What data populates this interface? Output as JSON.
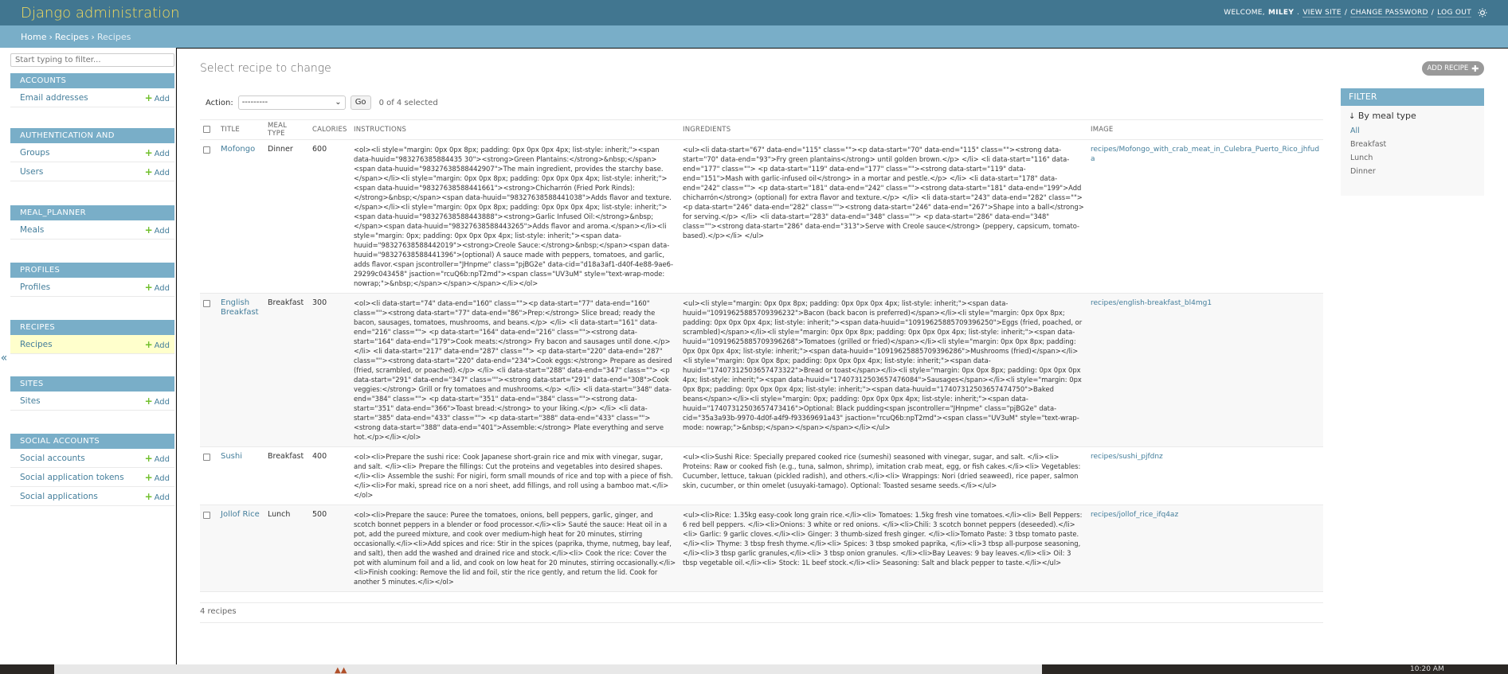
{
  "header": {
    "branding": "Django administration",
    "welcome": "WELCOME,",
    "username": "MILEY",
    "view_site": "VIEW SITE",
    "change_password": "CHANGE PASSWORD",
    "log_out": "LOG OUT",
    "sep": "/"
  },
  "breadcrumbs": {
    "home": "Home",
    "app": "Recipes",
    "current": "Recipes",
    "sep": "›"
  },
  "sidebar": {
    "filter_placeholder": "Start typing to filter...",
    "toggle": "«",
    "add_label": "Add",
    "modules": [
      {
        "caption": "ACCOUNTS",
        "rows": [
          "Email addresses"
        ]
      },
      {
        "caption": "AUTHENTICATION AND AUTHORIZATION",
        "rows": [
          "Groups",
          "Users"
        ]
      },
      {
        "caption": "MEAL_PLANNER",
        "rows": [
          "Meals"
        ]
      },
      {
        "caption": "PROFILES",
        "rows": [
          "Profiles"
        ]
      },
      {
        "caption": "RECIPES",
        "rows": [
          "Recipes"
        ]
      },
      {
        "caption": "SITES",
        "rows": [
          "Sites"
        ]
      },
      {
        "caption": "SOCIAL ACCOUNTS",
        "rows": [
          "Social accounts",
          "Social application tokens",
          "Social applications"
        ]
      }
    ]
  },
  "content": {
    "title": "Select recipe to change",
    "add_button": "ADD RECIPE",
    "action_label": "Action:",
    "action_value": "---------",
    "go_label": "Go",
    "counter": "0 of 4 selected",
    "paginator": "4 recipes"
  },
  "table": {
    "headers": [
      "TITLE",
      "MEAL TYPE",
      "CALORIES",
      "INSTRUCTIONS",
      "INGREDIENTS",
      "IMAGE"
    ],
    "rows": [
      {
        "title": "Mofongo",
        "meal_type": "Dinner",
        "calories": "600",
        "instructions": "<ol><li style=\"margin: 0px 0px 8px; padding: 0px 0px 0px 4px; list-style: inherit;\"><span data-huuid=\"983276385884435 30\"><strong>Green Plantains:</strong>&nbsp;</span><span data-huuid=\"98327638588442907\">The main ingredient, provides the starchy base.</span></li><li style=\"margin: 0px 0px 8px; padding: 0px 0px 0px 4px; list-style: inherit;\"><span data-huuid=\"98327638588441661\"><strong>Chicharrón (Fried Pork Rinds):</strong>&nbsp;</span><span data-huuid=\"98327638588441038\">Adds flavor and texture.</span></li><li style=\"margin: 0px 0px 8px; padding: 0px 0px 0px 4px; list-style: inherit;\"><span data-huuid=\"98327638588443888\"><strong>Garlic Infused Oil:</strong>&nbsp;</span><span data-huuid=\"98327638588443265\">Adds flavor and aroma.</span></li><li style=\"margin: 0px; padding: 0px 0px 0px 4px; list-style: inherit;\"><span data-huuid=\"98327638588442019\"><strong>Creole Sauce:</strong>&nbsp;</span><span data-huuid=\"98327638588441396\">(optional) A sauce made with peppers, tomatoes, and garlic, adds flavor.<span jscontroller=\"JHnpme\" class=\"pjBG2e\" data-cid=\"d18a3af1-d40f-4e88-9ae6-29299c043458\" jsaction=\"rcuQ6b:npT2md\"><span class=\"UV3uM\" style=\"text-wrap-mode: nowrap;\">&nbsp;</span></span></span></li></ol>",
        "ingredients": "<ul><li data-start=\"67\" data-end=\"115\" class=\"\"><p data-start=\"70\" data-end=\"115\" class=\"\"><strong data-start=\"70\" data-end=\"93\">Fry green plantains</strong> until golden brown.</p> </li> <li data-start=\"116\" data-end=\"177\" class=\"\"> <p data-start=\"119\" data-end=\"177\" class=\"\"><strong data-start=\"119\" data-end=\"151\">Mash with garlic-infused oil</strong> in a mortar and pestle.</p> </li> <li data-start=\"178\" data-end=\"242\" class=\"\"> <p data-start=\"181\" data-end=\"242\" class=\"\"><strong data-start=\"181\" data-end=\"199\">Add chicharrón</strong> (optional) for extra flavor and texture.</p> </li> <li data-start=\"243\" data-end=\"282\" class=\"\"> <p data-start=\"246\" data-end=\"282\" class=\"\"><strong data-start=\"246\" data-end=\"267\">Shape into a ball</strong> for serving.</p> </li> <li data-start=\"283\" data-end=\"348\" class=\"\"> <p data-start=\"286\" data-end=\"348\" class=\"\"><strong data-start=\"286\" data-end=\"313\">Serve with Creole sauce</strong> (peppery, capsicum, tomato-based).</p></li> </ul>",
        "image": "recipes/Mofongo_with_crab_meat_in_Culebra_Puerto_Rico_jhfuda"
      },
      {
        "title": "English Breakfast",
        "meal_type": "Breakfast",
        "calories": "300",
        "instructions": "<ol><li data-start=\"74\" data-end=\"160\" class=\"\"><p data-start=\"77\" data-end=\"160\" class=\"\"><strong data-start=\"77\" data-end=\"86\">Prep:</strong> Slice bread; ready the bacon, sausages, tomatoes, mushrooms, and beans.</p> </li> <li data-start=\"161\" data-end=\"216\" class=\"\"> <p data-start=\"164\" data-end=\"216\" class=\"\"><strong data-start=\"164\" data-end=\"179\">Cook meats:</strong> Fry bacon and sausages until done.</p> </li> <li data-start=\"217\" data-end=\"287\" class=\"\"> <p data-start=\"220\" data-end=\"287\" class=\"\"><strong data-start=\"220\" data-end=\"234\">Cook eggs:</strong> Prepare as desired (fried, scrambled, or poached).</p> </li> <li data-start=\"288\" data-end=\"347\" class=\"\"> <p data-start=\"291\" data-end=\"347\" class=\"\"><strong data-start=\"291\" data-end=\"308\">Cook veggies:</strong> Grill or fry tomatoes and mushrooms.</p> </li> <li data-start=\"348\" data-end=\"384\" class=\"\"> <p data-start=\"351\" data-end=\"384\" class=\"\"><strong data-start=\"351\" data-end=\"366\">Toast bread:</strong> to your liking.</p> </li> <li data-start=\"385\" data-end=\"433\" class=\"\"> <p data-start=\"388\" data-end=\"433\" class=\"\"><strong data-start=\"388\" data-end=\"401\">Assemble:</strong> Plate everything and serve hot.</p></li></ol>",
        "ingredients": "<ul><li style=\"margin: 0px 0px 8px; padding: 0px 0px 0px 4px; list-style: inherit;\"><span data-huuid=\"10919625885709396232\">Bacon (back bacon is preferred)</span></li><li style=\"margin: 0px 0px 8px; padding: 0px 0px 0px 4px; list-style: inherit;\"><span data-huuid=\"10919625885709396250\">Eggs (fried, poached, or scrambled)</span></li><li style=\"margin: 0px 0px 8px; padding: 0px 0px 0px 4px; list-style: inherit;\"><span data-huuid=\"10919625885709396268\">Tomatoes (grilled or fried)</span></li><li style=\"margin: 0px 0px 8px; padding: 0px 0px 0px 4px; list-style: inherit;\"><span data-huuid=\"10919625885709396286\">Mushrooms (fried)</span></li><li style=\"margin: 0px 0px 8px; padding: 0px 0px 0px 4px; list-style: inherit;\"><span data-huuid=\"17407312503657473322\">Bread or toast</span></li><li style=\"margin: 0px 0px 8px; padding: 0px 0px 0px 4px; list-style: inherit;\"><span data-huuid=\"17407312503657476084\">Sausages</span></li><li style=\"margin: 0px 0px 8px; padding: 0px 0px 0px 4px; list-style: inherit;\"><span data-huuid=\"17407312503657474750\">Baked beans</span></li><li style=\"margin: 0px; padding: 0px 0px 0px 4px; list-style: inherit;\"><span data-huuid=\"17407312503657473416\">Optional: Black pudding<span jscontroller=\"JHnpme\" class=\"pjBG2e\" data-cid=\"35a3a93b-9970-4d0f-a4f9-f93369691a43\" jsaction=\"rcuQ6b:npT2md\"><span class=\"UV3uM\" style=\"text-wrap-mode: nowrap;\">&nbsp;</span></span></span></li></ul>",
        "image": "recipes/english-breakfast_bl4mg1"
      },
      {
        "title": "Sushi",
        "meal_type": "Breakfast",
        "calories": "400",
        "instructions": "<ol><li>Prepare the sushi rice: Cook Japanese short-grain rice and mix with vinegar, sugar, and salt. </li><li> Prepare the fillings: Cut the proteins and vegetables into desired shapes.</li><li> Assemble the sushi: For nigiri, form small mounds of rice and top with a piece of fish. </li><li>For maki, spread rice on a nori sheet, add fillings, and roll using a bamboo mat.</li></ol>",
        "ingredients": "<ul><li>Sushi Rice: Specially prepared cooked rice (sumeshi) seasoned with vinegar, sugar, and salt. </li><li> Proteins: Raw or cooked fish (e.g., tuna, salmon, shrimp), imitation crab meat, egg, or fish cakes.</li><li> Vegetables: Cucumber, lettuce, takuan (pickled radish), and others.</li><li> Wrappings: Nori (dried seaweed), rice paper, salmon skin, cucumber, or thin omelet (usuyaki-tamago). Optional: Toasted sesame seeds.</li></ul>",
        "image": "recipes/sushi_pjfdnz"
      },
      {
        "title": "Jollof Rice",
        "meal_type": "Lunch",
        "calories": "500",
        "instructions": "<ol><li>Prepare the sauce: Puree the tomatoes, onions, bell peppers, garlic, ginger, and scotch bonnet peppers in a blender or food processor.</li><li> Sauté the sauce: Heat oil in a pot, add the pureed mixture, and cook over medium-high heat for 20 minutes, stirring occasionally.</li><li>Add spices and rice: Stir in the spices (paprika, thyme, nutmeg, bay leaf, and salt), then add the washed and drained rice and stock.</li><li> Cook the rice: Cover the pot with aluminum foil and a lid, and cook on low heat for 20 minutes, stirring occasionally.</li><li>Finish cooking: Remove the lid and foil, stir the rice gently, and return the lid. Cook for another 5 minutes.</li></ol>",
        "ingredients": "<ul><li>Rice: 1.35kg easy-cook long grain rice.</li><li> Tomatoes: 1.5kg fresh vine tomatoes.</li><li> Bell Peppers: 6 red bell peppers. </li><li>Onions: 3 white or red onions. </li><li>Chili: 3 scotch bonnet peppers (deseeded).</li><li> Garlic: 9 garlic cloves.</li><li> Ginger: 3 thumb-sized fresh ginger. </li><li>Tomato Paste: 3 tbsp tomato paste.</li><li> Thyme: 3 tbsp fresh thyme.</li><li> Spices: 3 tbsp smoked paprika, </li><li>3 tbsp all-purpose seasoning, </li><li>3 tbsp garlic granules,</li><li> 3 tbsp onion granules. </li><li>Bay Leaves: 9 bay leaves.</li><li> Oil: 3 tbsp vegetable oil.</li><li> Stock: 1L beef stock.</li><li> Seasoning: Salt and black pepper to taste.</li></ul>",
        "image": "recipes/jollof_rice_ifq4az"
      }
    ]
  },
  "filter": {
    "title": "FILTER",
    "heading": "By meal type",
    "options": [
      "All",
      "Breakfast",
      "Lunch",
      "Dinner"
    ],
    "selected": "All"
  },
  "taskbar": {
    "clock": "10:20 AM"
  },
  "colors": {
    "header_bg": "#417690",
    "branding": "#f5dd5d",
    "breadcrumb_bg": "#79aec8",
    "module_caption_bg": "#79aec8",
    "link": "#447e9b",
    "add_plus": "#70bf2b",
    "current_row": "#ffffcc"
  }
}
